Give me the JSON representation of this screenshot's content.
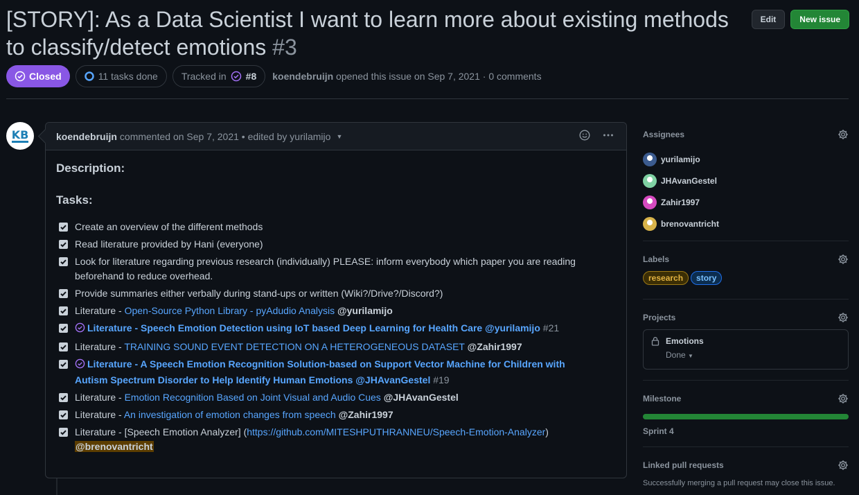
{
  "issue": {
    "title": "[STORY]: As a Data Scientist I want to learn more about existing methods to classify/detect emotions",
    "number": "#3",
    "state": "Closed",
    "tasks_done": "11 tasks done",
    "tracked_in_label": "Tracked in",
    "tracked_in_ref": "#8",
    "author": "koendebruijn",
    "opened_text": "opened this issue on Sep 7, 2021 · 0 comments"
  },
  "actions": {
    "edit": "Edit",
    "new_issue": "New issue"
  },
  "comment": {
    "author": "koendebruijn",
    "meta": "commented on Sep 7, 2021 • edited by yurilamijo",
    "avatar_text": "KB",
    "description_heading": "Description:",
    "tasks_heading": "Tasks:",
    "tasks": [
      {
        "text": "Create an overview of the different methods"
      },
      {
        "text": "Read literature provided by Hani (everyone)"
      },
      {
        "text": "Look for literature regarding previous research (individually) PLEASE: inform everybody which paper you are reading beforehand to reduce overhead."
      },
      {
        "text": "Provide summaries either verbally during stand-ups or written (Wiki?/Drive?/Discord?)"
      },
      {
        "prefix": "Literature - ",
        "link": "Open-Source Python Library - pyAdudio Analysis",
        "mention": "@yurilamijo"
      },
      {
        "issue_link": "Literature - Speech Emotion Detection using IoT based Deep Learning for Health Care @yurilamijo",
        "ref": "#21"
      },
      {
        "prefix": "Literature - ",
        "link": "TRAINING SOUND EVENT DETECTION ON A HETEROGENEOUS DATASET",
        "mention": "@Zahir1997"
      },
      {
        "issue_link": "Literature - A Speech Emotion Recognition Solution-based on Support Vector Machine for Children with Autism Spectrum Disorder to Help Identify Human Emotions @JHAvanGestel",
        "ref": "#19"
      },
      {
        "prefix": "Literature - ",
        "link": "Emotion Recognition Based on Joint Visual and Audio Cues",
        "mention": "@JHAvanGestel"
      },
      {
        "prefix": "Literature - ",
        "link": "An investigation of emotion changes from speech",
        "mention": "@Zahir1997"
      },
      {
        "prefix": "Literature - [Speech Emotion Analyzer] (",
        "link": "https://github.com/MITESHPUTHRANNEU/Speech-Emotion-Analyzer",
        "suffix": ")",
        "mention": "@brenovantricht"
      }
    ]
  },
  "sidebar": {
    "assignees": {
      "title": "Assignees",
      "people": [
        {
          "name": "yurilamijo",
          "color": "#3b5b8f"
        },
        {
          "name": "JHAvanGestel",
          "color": "#7fd1a3"
        },
        {
          "name": "Zahir1997",
          "color": "#d64ac0"
        },
        {
          "name": "brenovantricht",
          "color": "#d8b34a"
        }
      ]
    },
    "labels": {
      "title": "Labels",
      "items": [
        {
          "name": "research",
          "bg": "#3b2e05",
          "fg": "#e3b341",
          "border": "#9e7a14"
        },
        {
          "name": "story",
          "bg": "#0c2d4f",
          "fg": "#79c0ff",
          "border": "#1f6feb"
        }
      ]
    },
    "projects": {
      "title": "Projects",
      "name": "Emotions",
      "status": "Done"
    },
    "milestone": {
      "title": "Milestone",
      "progress": 1.0,
      "name": "Sprint 4"
    },
    "linked_prs": {
      "title": "Linked pull requests",
      "hint": "Successfully merging a pull request may close this issue."
    }
  }
}
